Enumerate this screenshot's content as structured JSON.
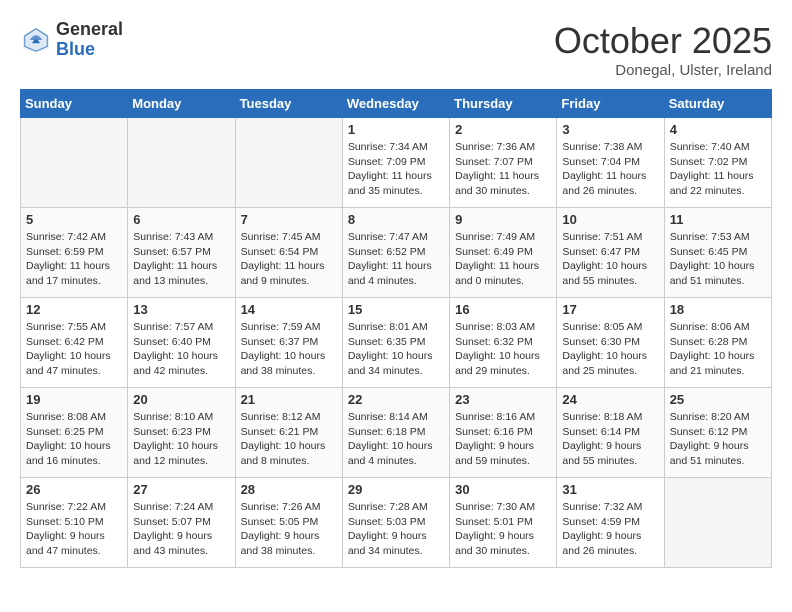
{
  "logo": {
    "general": "General",
    "blue": "Blue"
  },
  "title": "October 2025",
  "location": "Donegal, Ulster, Ireland",
  "days_of_week": [
    "Sunday",
    "Monday",
    "Tuesday",
    "Wednesday",
    "Thursday",
    "Friday",
    "Saturday"
  ],
  "weeks": [
    [
      {
        "day": "",
        "sunrise": "",
        "sunset": "",
        "daylight": "",
        "empty": true
      },
      {
        "day": "",
        "sunrise": "",
        "sunset": "",
        "daylight": "",
        "empty": true
      },
      {
        "day": "",
        "sunrise": "",
        "sunset": "",
        "daylight": "",
        "empty": true
      },
      {
        "day": "1",
        "sunrise": "Sunrise: 7:34 AM",
        "sunset": "Sunset: 7:09 PM",
        "daylight": "Daylight: 11 hours and 35 minutes."
      },
      {
        "day": "2",
        "sunrise": "Sunrise: 7:36 AM",
        "sunset": "Sunset: 7:07 PM",
        "daylight": "Daylight: 11 hours and 30 minutes."
      },
      {
        "day": "3",
        "sunrise": "Sunrise: 7:38 AM",
        "sunset": "Sunset: 7:04 PM",
        "daylight": "Daylight: 11 hours and 26 minutes."
      },
      {
        "day": "4",
        "sunrise": "Sunrise: 7:40 AM",
        "sunset": "Sunset: 7:02 PM",
        "daylight": "Daylight: 11 hours and 22 minutes."
      }
    ],
    [
      {
        "day": "5",
        "sunrise": "Sunrise: 7:42 AM",
        "sunset": "Sunset: 6:59 PM",
        "daylight": "Daylight: 11 hours and 17 minutes."
      },
      {
        "day": "6",
        "sunrise": "Sunrise: 7:43 AM",
        "sunset": "Sunset: 6:57 PM",
        "daylight": "Daylight: 11 hours and 13 minutes."
      },
      {
        "day": "7",
        "sunrise": "Sunrise: 7:45 AM",
        "sunset": "Sunset: 6:54 PM",
        "daylight": "Daylight: 11 hours and 9 minutes."
      },
      {
        "day": "8",
        "sunrise": "Sunrise: 7:47 AM",
        "sunset": "Sunset: 6:52 PM",
        "daylight": "Daylight: 11 hours and 4 minutes."
      },
      {
        "day": "9",
        "sunrise": "Sunrise: 7:49 AM",
        "sunset": "Sunset: 6:49 PM",
        "daylight": "Daylight: 11 hours and 0 minutes."
      },
      {
        "day": "10",
        "sunrise": "Sunrise: 7:51 AM",
        "sunset": "Sunset: 6:47 PM",
        "daylight": "Daylight: 10 hours and 55 minutes."
      },
      {
        "day": "11",
        "sunrise": "Sunrise: 7:53 AM",
        "sunset": "Sunset: 6:45 PM",
        "daylight": "Daylight: 10 hours and 51 minutes."
      }
    ],
    [
      {
        "day": "12",
        "sunrise": "Sunrise: 7:55 AM",
        "sunset": "Sunset: 6:42 PM",
        "daylight": "Daylight: 10 hours and 47 minutes."
      },
      {
        "day": "13",
        "sunrise": "Sunrise: 7:57 AM",
        "sunset": "Sunset: 6:40 PM",
        "daylight": "Daylight: 10 hours and 42 minutes."
      },
      {
        "day": "14",
        "sunrise": "Sunrise: 7:59 AM",
        "sunset": "Sunset: 6:37 PM",
        "daylight": "Daylight: 10 hours and 38 minutes."
      },
      {
        "day": "15",
        "sunrise": "Sunrise: 8:01 AM",
        "sunset": "Sunset: 6:35 PM",
        "daylight": "Daylight: 10 hours and 34 minutes."
      },
      {
        "day": "16",
        "sunrise": "Sunrise: 8:03 AM",
        "sunset": "Sunset: 6:32 PM",
        "daylight": "Daylight: 10 hours and 29 minutes."
      },
      {
        "day": "17",
        "sunrise": "Sunrise: 8:05 AM",
        "sunset": "Sunset: 6:30 PM",
        "daylight": "Daylight: 10 hours and 25 minutes."
      },
      {
        "day": "18",
        "sunrise": "Sunrise: 8:06 AM",
        "sunset": "Sunset: 6:28 PM",
        "daylight": "Daylight: 10 hours and 21 minutes."
      }
    ],
    [
      {
        "day": "19",
        "sunrise": "Sunrise: 8:08 AM",
        "sunset": "Sunset: 6:25 PM",
        "daylight": "Daylight: 10 hours and 16 minutes."
      },
      {
        "day": "20",
        "sunrise": "Sunrise: 8:10 AM",
        "sunset": "Sunset: 6:23 PM",
        "daylight": "Daylight: 10 hours and 12 minutes."
      },
      {
        "day": "21",
        "sunrise": "Sunrise: 8:12 AM",
        "sunset": "Sunset: 6:21 PM",
        "daylight": "Daylight: 10 hours and 8 minutes."
      },
      {
        "day": "22",
        "sunrise": "Sunrise: 8:14 AM",
        "sunset": "Sunset: 6:18 PM",
        "daylight": "Daylight: 10 hours and 4 minutes."
      },
      {
        "day": "23",
        "sunrise": "Sunrise: 8:16 AM",
        "sunset": "Sunset: 6:16 PM",
        "daylight": "Daylight: 9 hours and 59 minutes."
      },
      {
        "day": "24",
        "sunrise": "Sunrise: 8:18 AM",
        "sunset": "Sunset: 6:14 PM",
        "daylight": "Daylight: 9 hours and 55 minutes."
      },
      {
        "day": "25",
        "sunrise": "Sunrise: 8:20 AM",
        "sunset": "Sunset: 6:12 PM",
        "daylight": "Daylight: 9 hours and 51 minutes."
      }
    ],
    [
      {
        "day": "26",
        "sunrise": "Sunrise: 7:22 AM",
        "sunset": "Sunset: 5:10 PM",
        "daylight": "Daylight: 9 hours and 47 minutes."
      },
      {
        "day": "27",
        "sunrise": "Sunrise: 7:24 AM",
        "sunset": "Sunset: 5:07 PM",
        "daylight": "Daylight: 9 hours and 43 minutes."
      },
      {
        "day": "28",
        "sunrise": "Sunrise: 7:26 AM",
        "sunset": "Sunset: 5:05 PM",
        "daylight": "Daylight: 9 hours and 38 minutes."
      },
      {
        "day": "29",
        "sunrise": "Sunrise: 7:28 AM",
        "sunset": "Sunset: 5:03 PM",
        "daylight": "Daylight: 9 hours and 34 minutes."
      },
      {
        "day": "30",
        "sunrise": "Sunrise: 7:30 AM",
        "sunset": "Sunset: 5:01 PM",
        "daylight": "Daylight: 9 hours and 30 minutes."
      },
      {
        "day": "31",
        "sunrise": "Sunrise: 7:32 AM",
        "sunset": "Sunset: 4:59 PM",
        "daylight": "Daylight: 9 hours and 26 minutes."
      },
      {
        "day": "",
        "sunrise": "",
        "sunset": "",
        "daylight": "",
        "empty": true
      }
    ]
  ]
}
